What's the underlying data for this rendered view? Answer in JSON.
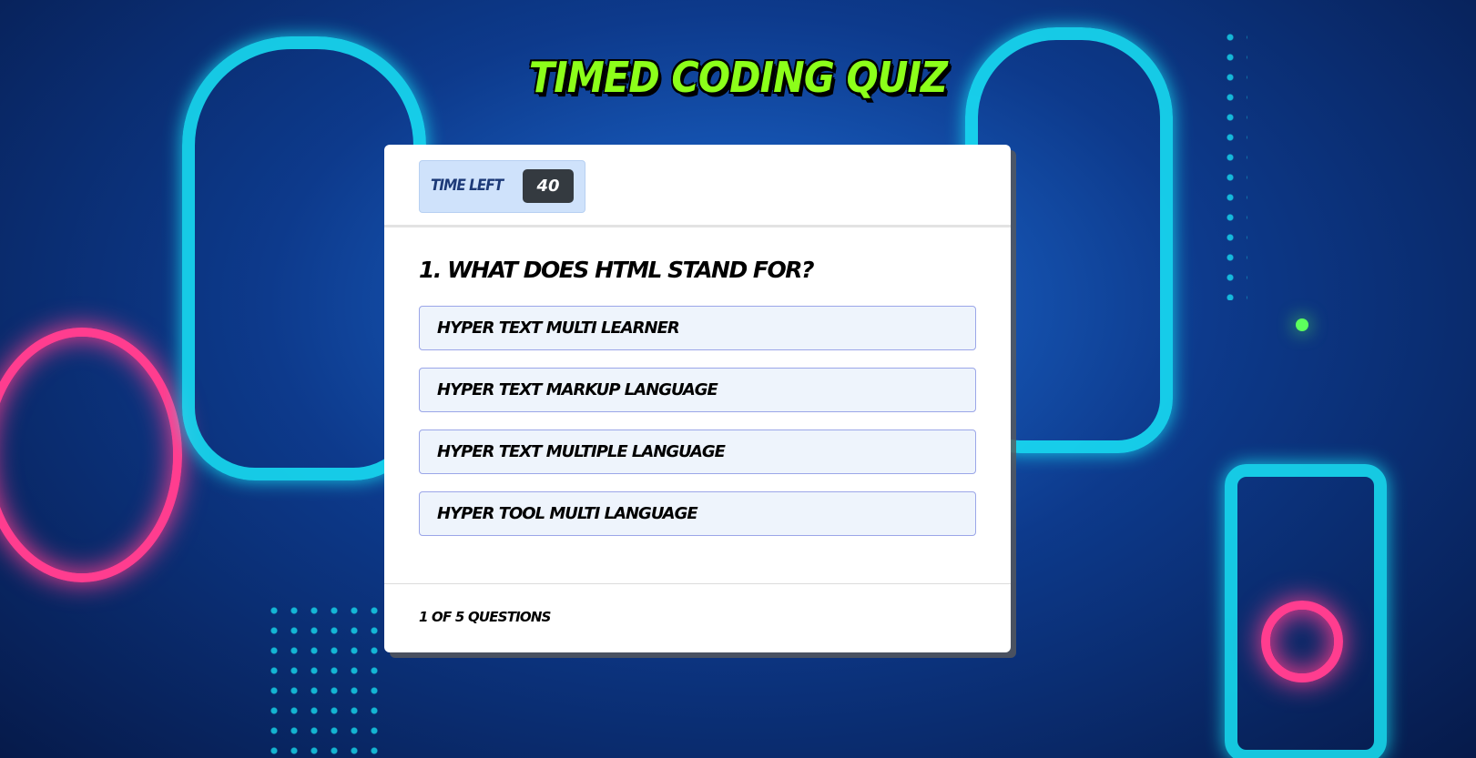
{
  "app": {
    "title": "TIMED CODING QUIZ"
  },
  "timer": {
    "label": "TIME LEFT",
    "value": "40"
  },
  "question": {
    "text": "1. WHAT DOES HTML STAND FOR?"
  },
  "answers": [
    {
      "label": "HYPER TEXT MULTI LEARNER"
    },
    {
      "label": "HYPER TEXT MARKUP LANGUAGE"
    },
    {
      "label": "HYPER TEXT MULTIPLE LANGUAGE"
    },
    {
      "label": "HYPER TOOL MULTI LANGUAGE"
    }
  ],
  "footer": {
    "progress": "1 OF 5 QUESTIONS"
  },
  "colors": {
    "title": "#8cff1a",
    "background": "#0d3a8c",
    "timer_bg": "#cfe2fb",
    "timer_value_bg": "#343a40",
    "answer_bg": "#eef4fc",
    "answer_border": "#9ba6e8"
  }
}
